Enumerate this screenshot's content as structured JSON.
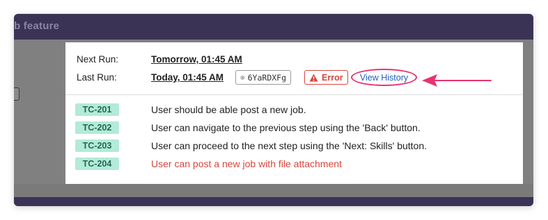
{
  "background": {
    "title": "b feature"
  },
  "schedule": {
    "next_run_label": "Next Run:",
    "next_run_value": "Tomorrow, 01:45 AM",
    "last_run_label": "Last Run:",
    "last_run_value": "Today, 01:45 AM",
    "run_id": "6YaRDXFg",
    "status_label": "Error",
    "view_history_label": "View History"
  },
  "test_cases": [
    {
      "id": "TC-201",
      "title": "User should be able post a new job.",
      "failed": false
    },
    {
      "id": "TC-202",
      "title": "User can navigate to the previous step using the 'Back' button.",
      "failed": false
    },
    {
      "id": "TC-203",
      "title": "User can proceed to the next step using the 'Next: Skills' button.",
      "failed": false
    },
    {
      "id": "TC-204",
      "title": "User can post a new job with file attachment",
      "failed": true
    }
  ],
  "colors": {
    "header_bg": "#3b3356",
    "tag_bg": "#b4ead8",
    "tag_text": "#1f6a55",
    "error": "#d6453d",
    "link": "#1f5fc4",
    "highlight": "#e8336e"
  }
}
